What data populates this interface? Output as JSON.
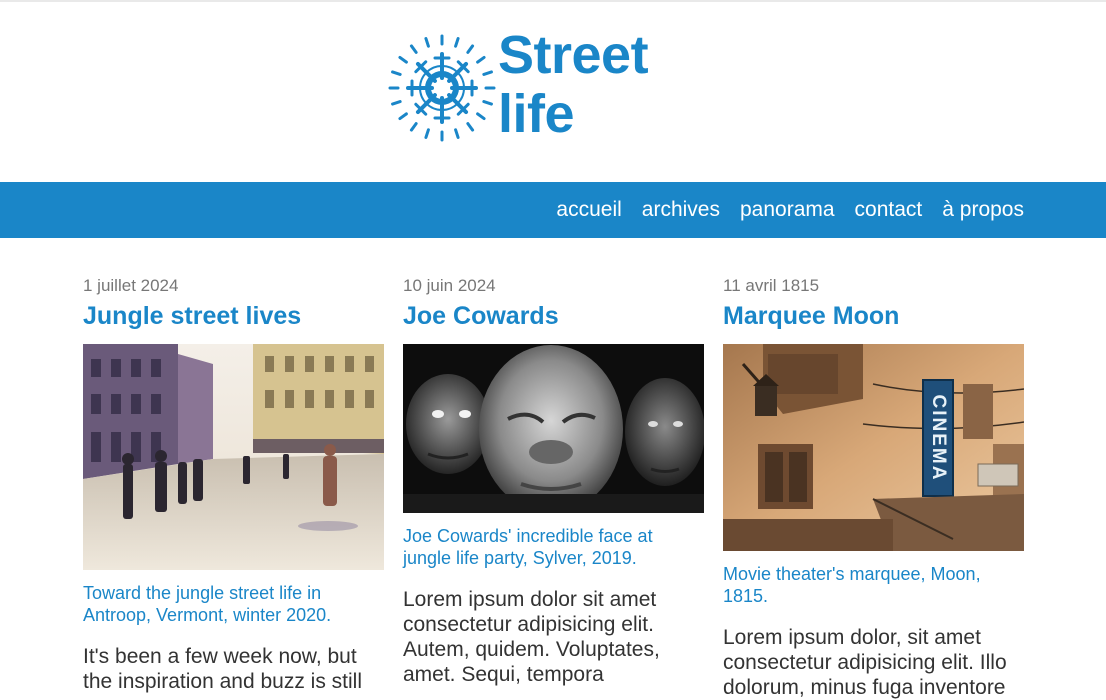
{
  "site": {
    "logo_icon": "snowflake-icon",
    "brand_color": "#1a86c8",
    "title_line1": "Street",
    "title_line2": "life"
  },
  "nav": {
    "items": [
      "accueil",
      "archives",
      "panorama",
      "contact",
      "à propos"
    ]
  },
  "articles": [
    {
      "date": "1 juillet 2024",
      "title": "Jungle street lives",
      "caption": "Toward the jungle street life in Antroop, Vermont, winter 2020.",
      "excerpt": "It's been a few week now, but the inspiration and buzz is still"
    },
    {
      "date": "10 juin 2024",
      "title": "Joe Cowards",
      "caption": "Joe Cowards' incredible face at jungle life party, Sylver, 2019.",
      "excerpt": "Lorem ipsum dolor sit amet consectetur adipisicing elit. Autem, quidem. Voluptates, amet. Sequi, tempora"
    },
    {
      "date": "11 avril 1815",
      "title": "Marquee Moon",
      "caption": "Movie theater's marquee, Moon, 1815.",
      "sign_text": "CINEMA",
      "excerpt": "Lorem ipsum dolor, sit amet consectetur adipisicing elit. Illo dolorum, minus fuga inventore"
    }
  ]
}
